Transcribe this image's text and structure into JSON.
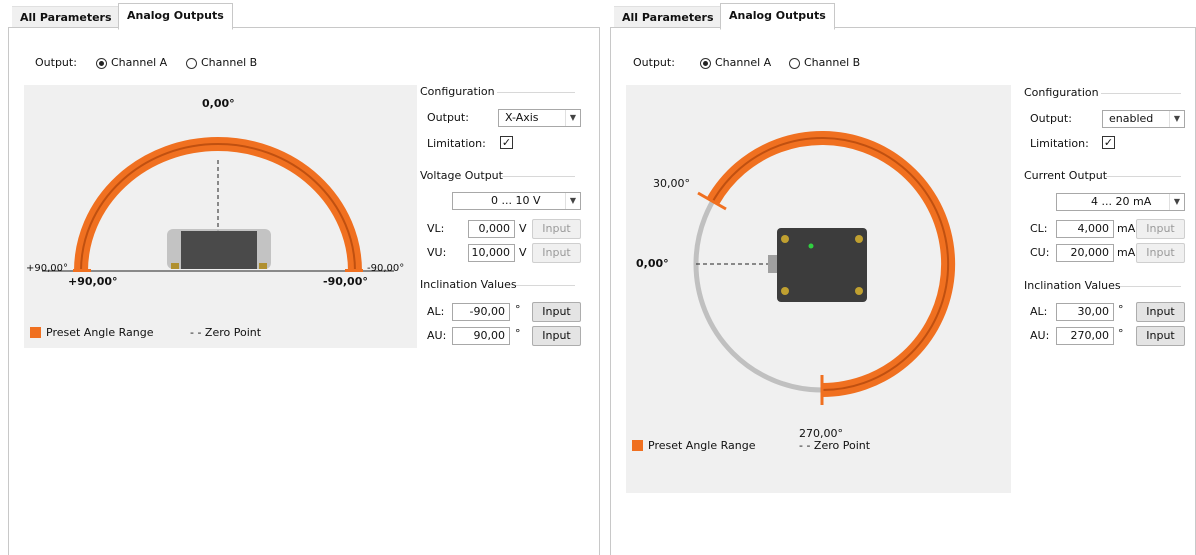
{
  "tabs": {
    "all": "All Parameters",
    "analog": "Analog Outputs"
  },
  "colors": {
    "accent": "#f07020",
    "arc_grey": "#c0c0c0"
  },
  "icons": {
    "radio": "radio-button-icon",
    "check": "checkmark-icon",
    "dropdown": "chevron-down-icon"
  },
  "left": {
    "output_label": "Output:",
    "channel_a": "Channel A",
    "channel_b": "Channel B",
    "selected_channel": "Channel A",
    "viz": {
      "top_angle": "0,00°",
      "left_outer": "+90,00°",
      "left_inner": "+90,00°",
      "right_inner": "-90,00°",
      "right_outer": "-90,00°",
      "legend_range": "Preset Angle Range",
      "legend_zero": "- - Zero Point"
    },
    "config": {
      "title": "Configuration",
      "output_label": "Output:",
      "output_value": "X-Axis",
      "limitation_label": "Limitation:",
      "limitation_checked": "✓"
    },
    "voltage": {
      "title": "Voltage Output",
      "range_value": "0 ... 10 V",
      "vl_label": "VL:",
      "vl_value": "0,000",
      "vl_unit": "V",
      "vu_label": "VU:",
      "vu_value": "10,000",
      "vu_unit": "V",
      "input_btn": "Input"
    },
    "incl": {
      "title": "Inclination Values",
      "al_label": "AL:",
      "al_value": "-90,00",
      "au_label": "AU:",
      "au_value": "90,00",
      "unit": "°",
      "input_btn": "Input"
    }
  },
  "right": {
    "output_label": "Output:",
    "channel_a": "Channel A",
    "channel_b": "Channel B",
    "selected_channel": "Channel A",
    "viz": {
      "upper_angle": "30,00°",
      "left_angle": "0,00°",
      "bottom_angle": "270,00°",
      "legend_range": "Preset Angle Range",
      "legend_zero": "- - Zero Point"
    },
    "config": {
      "title": "Configuration",
      "output_label": "Output:",
      "output_value": "enabled",
      "limitation_label": "Limitation:",
      "limitation_checked": "✓"
    },
    "current": {
      "title": "Current Output",
      "range_value": "4 ... 20 mA",
      "cl_label": "CL:",
      "cl_value": "4,000",
      "cl_unit": "mA",
      "cu_label": "CU:",
      "cu_value": "20,000",
      "cu_unit": "mA",
      "input_btn": "Input"
    },
    "incl": {
      "title": "Inclination Values",
      "al_label": "AL:",
      "al_value": "30,00",
      "au_label": "AU:",
      "au_value": "270,00",
      "unit": "°",
      "input_btn": "Input"
    }
  }
}
